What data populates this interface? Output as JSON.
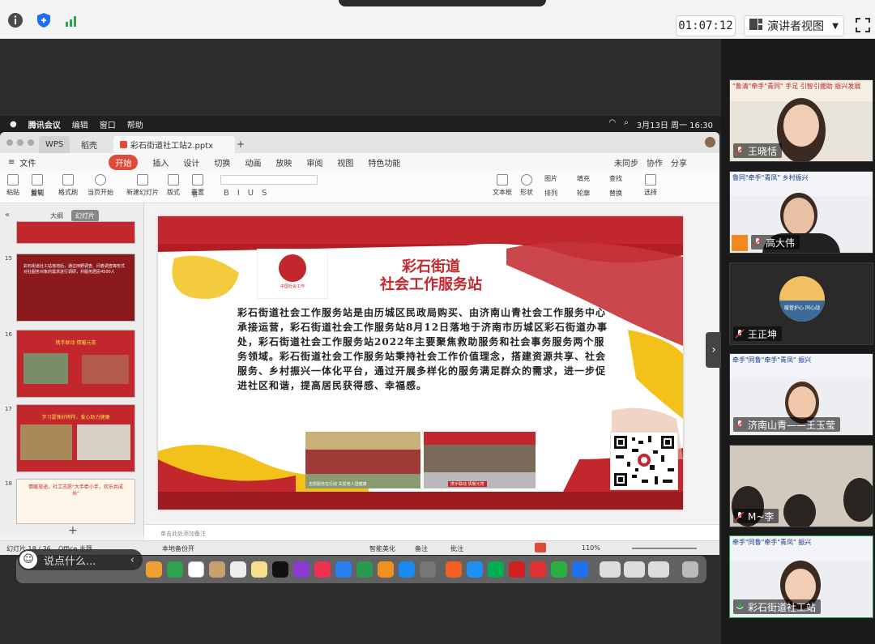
{
  "meeting_toolbar": {
    "timer": "01:07:12",
    "view_mode": "演讲者视图",
    "icons": [
      "info-icon",
      "shield-icon",
      "signal-icon",
      "fullscreen-icon"
    ]
  },
  "mac_menubar": {
    "app": "腾讯会议",
    "menus": [
      "编辑",
      "窗口",
      "帮助"
    ],
    "datetime": "3月13日 周一 16:30"
  },
  "wps": {
    "tabs": [
      {
        "label": "WPS"
      },
      {
        "label": "稻壳"
      },
      {
        "label": "彩石街道社工站2.pptx"
      }
    ],
    "file_menu": "文件",
    "ribbon_tabs": [
      "开始",
      "插入",
      "设计",
      "切换",
      "动画",
      "放映",
      "审阅",
      "视图",
      "特色功能"
    ],
    "ribbon_right": [
      "未同步",
      "协作",
      "分享"
    ],
    "ribbon_buttons": [
      "粘贴",
      "剪切",
      "复制",
      "格式刷",
      "当页开始",
      "新建幻灯片",
      "版式",
      "重置",
      "节",
      "文本框",
      "形状",
      "图片",
      "排列",
      "填充",
      "轮廓",
      "查找",
      "替换",
      "选择"
    ],
    "panel_tabs": [
      "大纲",
      "幻灯片"
    ],
    "thumbnails": [
      {
        "num": "15",
        "text": "彩石街道社工站落地后，通过田野调查、问卷调查等形式对社服务对象的需求进行调研，共服务居民4500人"
      },
      {
        "num": "16",
        "caption": "携手联动 情暖元宵"
      },
      {
        "num": "17",
        "caption": "学习雷锋好榜样，爱心助力健康"
      },
      {
        "num": "18",
        "caption": "情暖旅途，社工志愿\"大手牵小手，欢乐共成长\""
      }
    ],
    "slide": {
      "title_line1": "彩石街道",
      "title_line2": "社会工作服务站",
      "logo_caption": "中国社会工作",
      "body": "彩石街道社会工作服务站是由历城区民政局购买、由济南山青社会工作服务中心承接运营，彩石街道社会工作服务站8月12日落地于济南市历城区彩石街道办事处，彩石街道社会工作服务站2022年主要聚焦救助服务和社会事务服务两个服务领域。彩石街道社会工作服务站秉持社会工作价值理念，搭建资源共享、社会服务、乡村振兴一体化平台，通过开展多样化的服务满足群众的需求，进一步促进社区和谐，提高居民获得感、幸福感。",
      "photo1_caption": "志愿服务在行动 关爱老人送健康",
      "photo2_caption": "携手联动 情暖元宵"
    },
    "notes_placeholder": "单击此处添加备注",
    "status": {
      "slide_count": "幻灯片 18 / 36",
      "theme": "Office 主题",
      "backup": "本地备份开",
      "beautify": "智能美化",
      "notes": "备注",
      "comments": "批注",
      "zoom": "110%"
    }
  },
  "chat": {
    "placeholder": "说点什么..."
  },
  "participants": [
    {
      "name": "王晓恬",
      "banner": "\"鲁清\"牵手\"青同\" 手足 引智引援助 振兴发展"
    },
    {
      "name": "高大伟",
      "banner": "鲁同\"牵手\"青凤\" 乡村振兴"
    },
    {
      "name": "王正坤",
      "banner": "暖管护心 同心战"
    },
    {
      "name": "济南山青——王玉莹",
      "banner": "牵手\"同鲁\"牵手\"青凤\" 振兴"
    },
    {
      "name": "M~李",
      "banner": ""
    },
    {
      "name": "彩石街道社工站",
      "banner": "牵手\"同鲁\"牵手\"青凤\" 振兴"
    }
  ],
  "colors": {
    "accent_red": "#e04a3a",
    "slide_red": "#c1272d",
    "slide_yellow": "#f2c21b"
  }
}
